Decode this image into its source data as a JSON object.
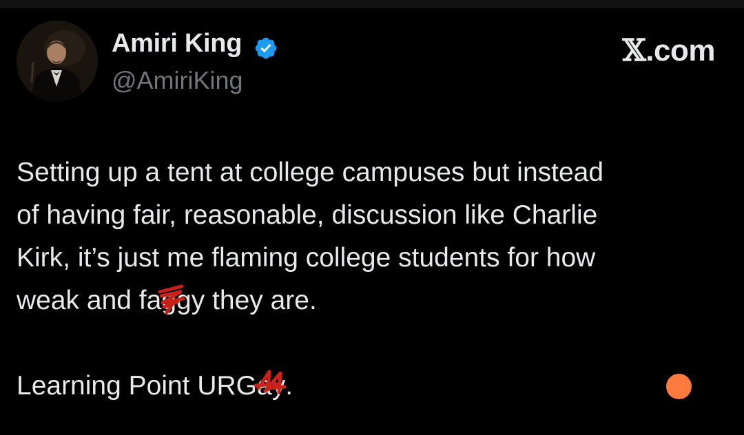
{
  "profile": {
    "display_name": "Amiri King",
    "handle": "@AmiriKing",
    "verified": true,
    "avatar_icon": "profile-photo"
  },
  "watermark": {
    "x_glyph": "𝕏",
    "suffix": ".com"
  },
  "tweet": {
    "lines": [
      "Setting up a tent at college campuses but instead",
      "of having fair, reasonable, discussion like Charlie",
      "Kirk, it’s just me flaming college students for how"
    ],
    "line4_before": "weak and fa",
    "line4_redacted": "gg",
    "line4_after": "y they are.",
    "line5_before": "Learning Point URG",
    "line5_redacted": "ay",
    "line5_after": "."
  },
  "colors": {
    "background": "#000000",
    "text": "#e7e9ea",
    "handle": "#71767b",
    "verified_blue": "#1d9bf0",
    "scribble_red": "#c8221b",
    "recording_dot": "#ff7a3d"
  }
}
